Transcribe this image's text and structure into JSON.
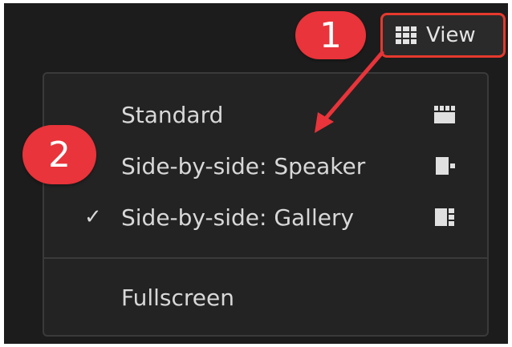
{
  "toolbar": {
    "view_label": "View",
    "view_icon": "grid-icon"
  },
  "callouts": {
    "step1": "1",
    "step2": "2",
    "color": "#e8343a"
  },
  "menu": {
    "items": [
      {
        "label": "Standard",
        "icon": "standard-layout-icon",
        "checked": false
      },
      {
        "label": "Side-by-side: Speaker",
        "icon": "speaker-layout-icon",
        "checked": false
      },
      {
        "label": "Side-by-side: Gallery",
        "icon": "gallery-layout-icon",
        "checked": true,
        "check_mark": "✓"
      },
      {
        "label": "Fullscreen",
        "checked": false
      }
    ]
  }
}
